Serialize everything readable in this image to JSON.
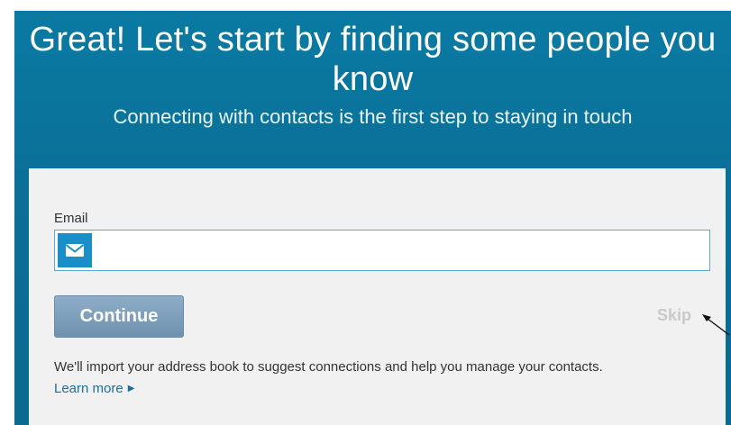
{
  "header": {
    "title": "Great! Let's start by finding some people you know",
    "subtitle": "Connecting with contacts is the first step to staying in touch"
  },
  "form": {
    "email_label": "Email",
    "email_value": "",
    "email_icon": "envelope-icon",
    "continue_label": "Continue",
    "skip_label": "Skip"
  },
  "footer": {
    "note": "We'll import your address book to suggest connections and help you manage your contacts.",
    "learn_more": "Learn more",
    "learn_more_icon": "caret-right-icon"
  },
  "colors": {
    "banner": "#0b6f96",
    "card": "#f1f1f1",
    "continue_button": "#7c9dba",
    "skip_link": "#c9c9c9",
    "link": "#1a6ea8",
    "icon_badge": "#1a8ec8"
  }
}
